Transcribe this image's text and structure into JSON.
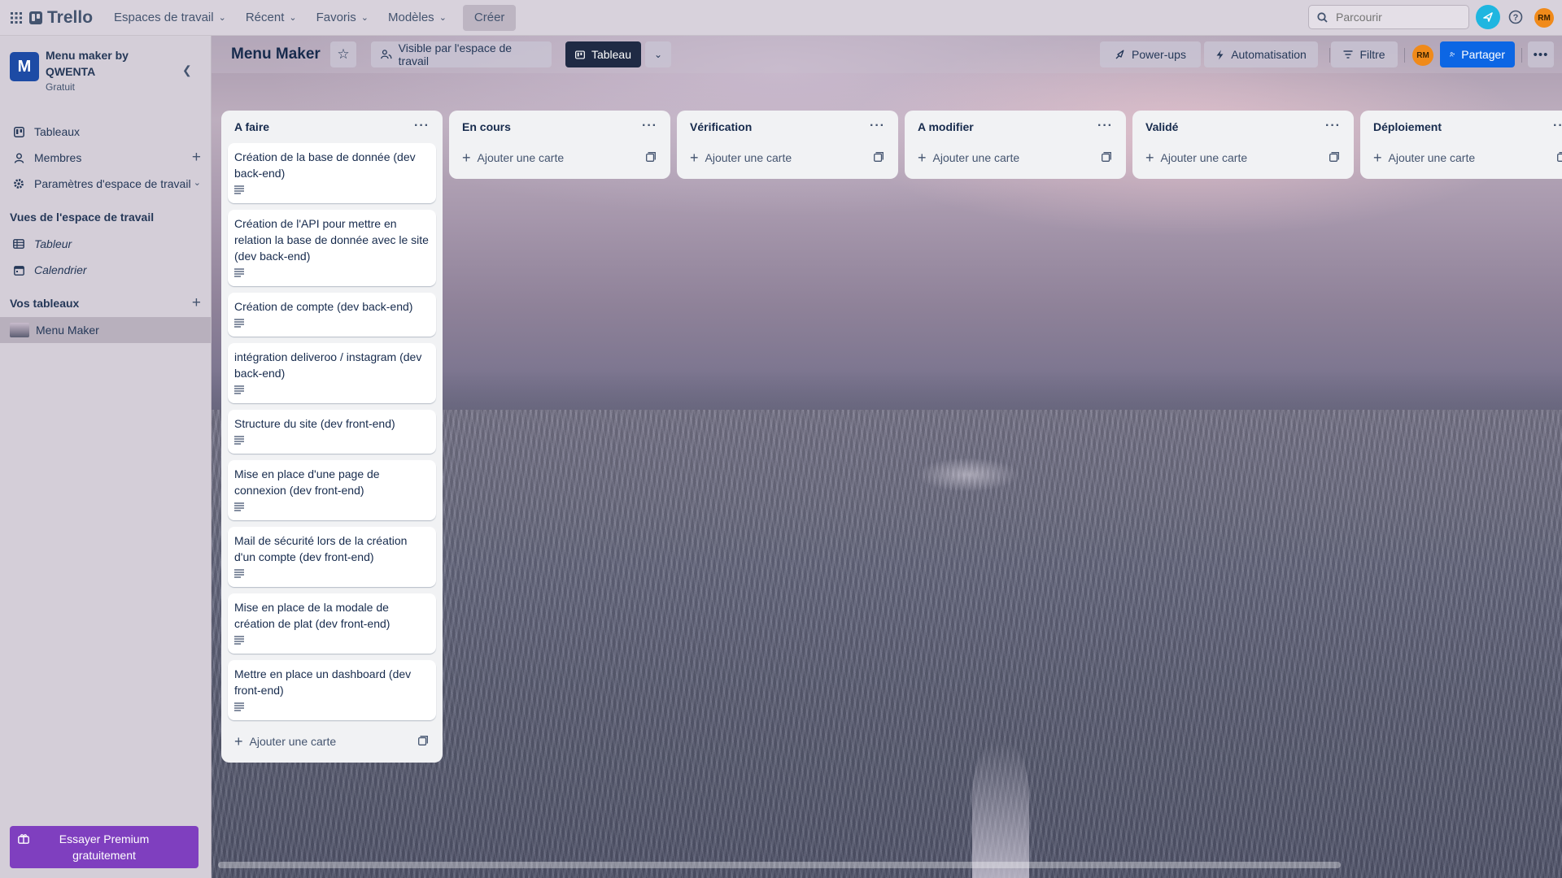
{
  "topbar": {
    "app_name": "Trello",
    "menus": [
      {
        "label": "Espaces de travail"
      },
      {
        "label": "Récent"
      },
      {
        "label": "Favoris"
      },
      {
        "label": "Modèles"
      }
    ],
    "create_label": "Créer",
    "search_placeholder": "Parcourir",
    "user_initials": "RM"
  },
  "sidebar": {
    "workspace_initial": "M",
    "workspace_name": "Menu maker by QWENTA",
    "workspace_plan": "Gratuit",
    "items": [
      {
        "label": "Tableaux",
        "icon": "trello-board-icon"
      },
      {
        "label": "Membres",
        "icon": "person-icon"
      },
      {
        "label": "Paramètres d'espace de travail",
        "icon": "gear-icon"
      }
    ],
    "views_heading": "Vues de l'espace de travail",
    "views": [
      {
        "label": "Tableur",
        "icon": "table-icon"
      },
      {
        "label": "Calendrier",
        "icon": "calendar-icon"
      }
    ],
    "boards_heading": "Vos tableaux",
    "boards": [
      {
        "label": "Menu Maker"
      }
    ],
    "premium_label": "Essayer Premium gratuitement"
  },
  "board": {
    "title": "Menu Maker",
    "visibility_label": "Visible par l'espace de travail",
    "view_label": "Tableau",
    "powerups_label": "Power-ups",
    "automation_label": "Automatisation",
    "filter_label": "Filtre",
    "member_initials": "RM",
    "share_label": "Partager",
    "add_card_label": "Ajouter une carte",
    "lists": [
      {
        "name": "A faire",
        "cards": [
          "Création de la base de donnée (dev back-end)",
          "Création de l'API pour mettre en relation la base de donnée avec le site (dev back-end)",
          "Création de compte (dev back-end)",
          "intégration deliveroo / instagram (dev back-end)",
          "Structure du site (dev front-end)",
          "Mise en place d'une page de connexion (dev front-end)",
          "Mail de sécurité lors de la création d'un compte (dev front-end)",
          "Mise en place de la modale de création de plat (dev front-end)",
          "Mettre en place un dashboard (dev front-end)"
        ]
      },
      {
        "name": "En cours",
        "cards": []
      },
      {
        "name": "Vérification",
        "cards": []
      },
      {
        "name": "A modifier",
        "cards": []
      },
      {
        "name": "Validé",
        "cards": []
      },
      {
        "name": "Déploiement",
        "cards": []
      }
    ]
  }
}
